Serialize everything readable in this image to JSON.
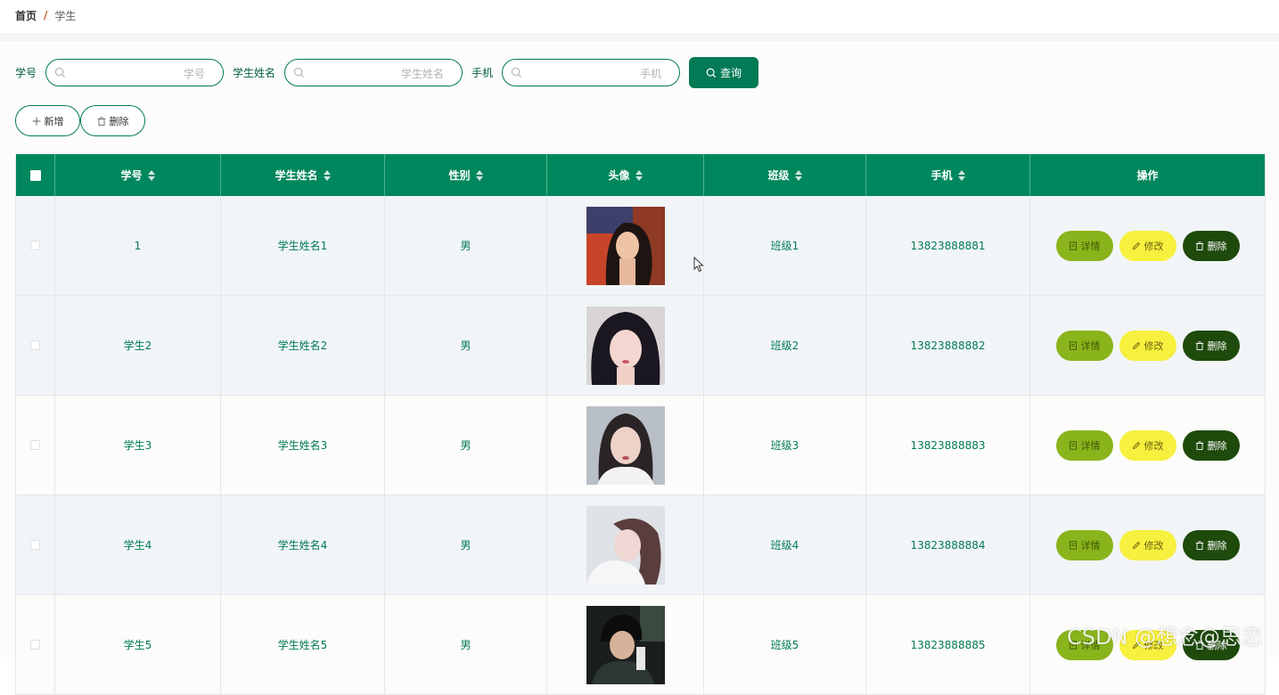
{
  "breadcrumb": {
    "home": "首页",
    "separator": "/",
    "current": "学生"
  },
  "search": {
    "fields": [
      {
        "label": "学号",
        "placeholder": "学号",
        "value": ""
      },
      {
        "label": "学生姓名",
        "placeholder": "学生姓名",
        "value": ""
      },
      {
        "label": "手机",
        "placeholder": "手机",
        "value": ""
      }
    ],
    "query_button": "查询"
  },
  "actions": {
    "add": "新增",
    "delete": "删除"
  },
  "table": {
    "headers": [
      "学号",
      "学生姓名",
      "性别",
      "头像",
      "班级",
      "手机",
      "操作"
    ],
    "rows": [
      {
        "id": "1",
        "name": "学生姓名1",
        "gender": "男",
        "class": "班级1",
        "phone": "13823888881"
      },
      {
        "id": "学生2",
        "name": "学生姓名2",
        "gender": "男",
        "class": "班级2",
        "phone": "13823888882"
      },
      {
        "id": "学生3",
        "name": "学生姓名3",
        "gender": "男",
        "class": "班级3",
        "phone": "13823888883"
      },
      {
        "id": "学生4",
        "name": "学生姓名4",
        "gender": "男",
        "class": "班级4",
        "phone": "13823888884"
      },
      {
        "id": "学生5",
        "name": "学生姓名5",
        "gender": "男",
        "class": "班级5",
        "phone": "13823888885"
      }
    ],
    "row_actions": {
      "detail": "详情",
      "edit": "修改",
      "delete": "删除"
    }
  },
  "colors": {
    "primary": "#017a55",
    "header_bg": "#01875d",
    "detail_btn": "#8ab41c",
    "edit_btn": "#f6f03e",
    "delete_btn": "#1e4a0c"
  },
  "watermark": "CSDN @想念@思恋"
}
